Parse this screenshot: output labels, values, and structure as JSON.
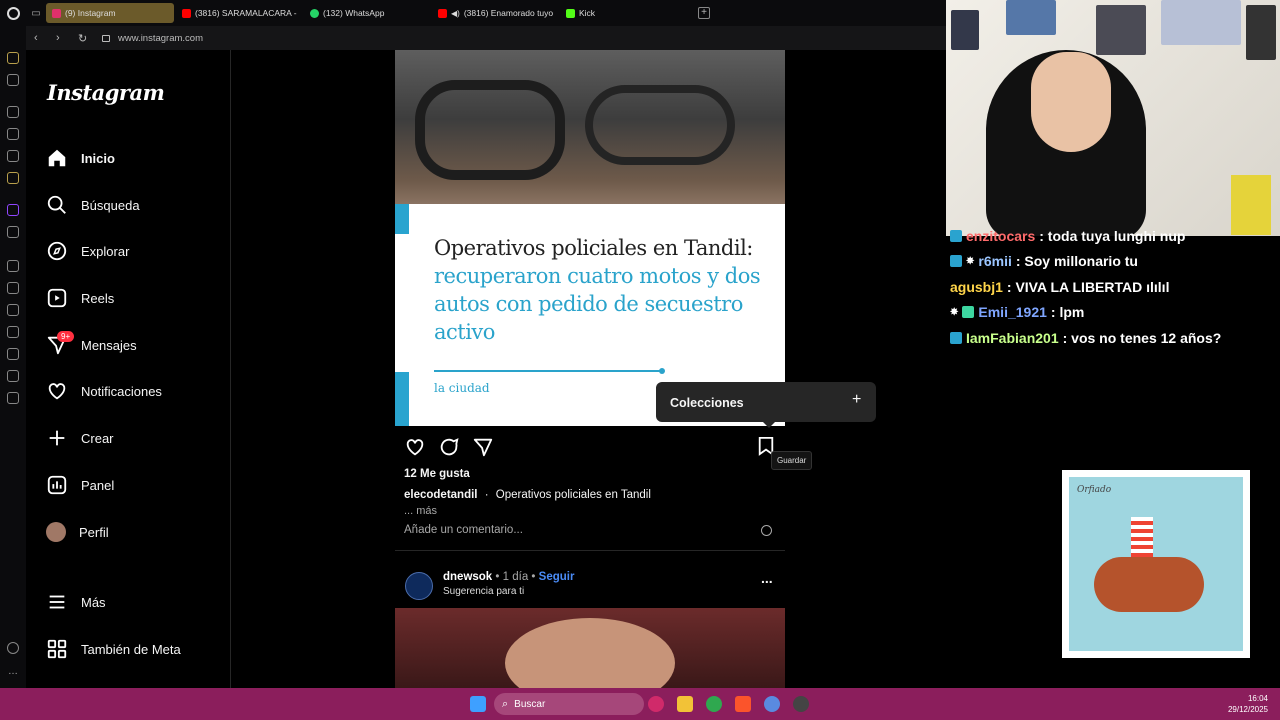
{
  "browser": {
    "tabs": [
      {
        "label": "(9) Instagram",
        "color": "#e1306c"
      },
      {
        "label": "(3816) SARAMALACARA -",
        "color": "#ff0000"
      },
      {
        "label": "(132) WhatsApp",
        "color": "#25d366"
      },
      {
        "label": "(3816) Enamorado tuyo",
        "color": "#ff0000"
      },
      {
        "label": "Kick",
        "color": "#53fc18"
      }
    ],
    "url": "www.instagram.com"
  },
  "instagram": {
    "logo": "Instagram",
    "nav": [
      {
        "label": "Inicio",
        "icon": "home-icon"
      },
      {
        "label": "Búsqueda",
        "icon": "search-icon"
      },
      {
        "label": "Explorar",
        "icon": "compass-icon"
      },
      {
        "label": "Reels",
        "icon": "reels-icon"
      },
      {
        "label": "Mensajes",
        "icon": "messages-icon",
        "badge": "9+"
      },
      {
        "label": "Notificaciones",
        "icon": "heart-icon"
      },
      {
        "label": "Crear",
        "icon": "plus-icon"
      },
      {
        "label": "Panel",
        "icon": "panel-icon"
      },
      {
        "label": "Perfil",
        "icon": "avatar"
      },
      {
        "label": "Más",
        "icon": "menu-icon"
      },
      {
        "label": "También de Meta",
        "icon": "meta-icon"
      }
    ],
    "post": {
      "headline_black": "Operativos policiales en Tandil:",
      "headline_blue": "recuperaron cuatro motos y dos autos con pedido de secuestro activo",
      "source": "la ciudad",
      "likes": "12 Me gusta",
      "author": "elecodetandil",
      "caption": "Operativos policiales en Tandil",
      "more": "... más",
      "comment_placeholder": "Añade un comentario..."
    },
    "collections_popup": {
      "title": "Colecciones",
      "add": "+"
    },
    "tooltip": "Guardar",
    "next_post": {
      "author": "dnewsok",
      "time": "• 1 día •",
      "follow": "Seguir",
      "subtitle": "Sugerencia para ti",
      "more": "..."
    }
  },
  "chat": {
    "messages": [
      {
        "user": "enzitocars",
        "text": ": toda tuya lunghi nup"
      },
      {
        "user": "r6mii",
        "text": ": Soy millonario tu"
      },
      {
        "user": "agusbj1",
        "text": ": VIVA LA LIBERTAD ılılıl"
      },
      {
        "user": "Emii_1921",
        "text": ": lpm"
      },
      {
        "user": "IamFabian201",
        "text": ": vos no tenes 12 años?"
      }
    ]
  },
  "album": {
    "title": "Orfiado"
  },
  "taskbar": {
    "search": "Buscar",
    "time": "16:04",
    "date": "29/12/2025"
  }
}
